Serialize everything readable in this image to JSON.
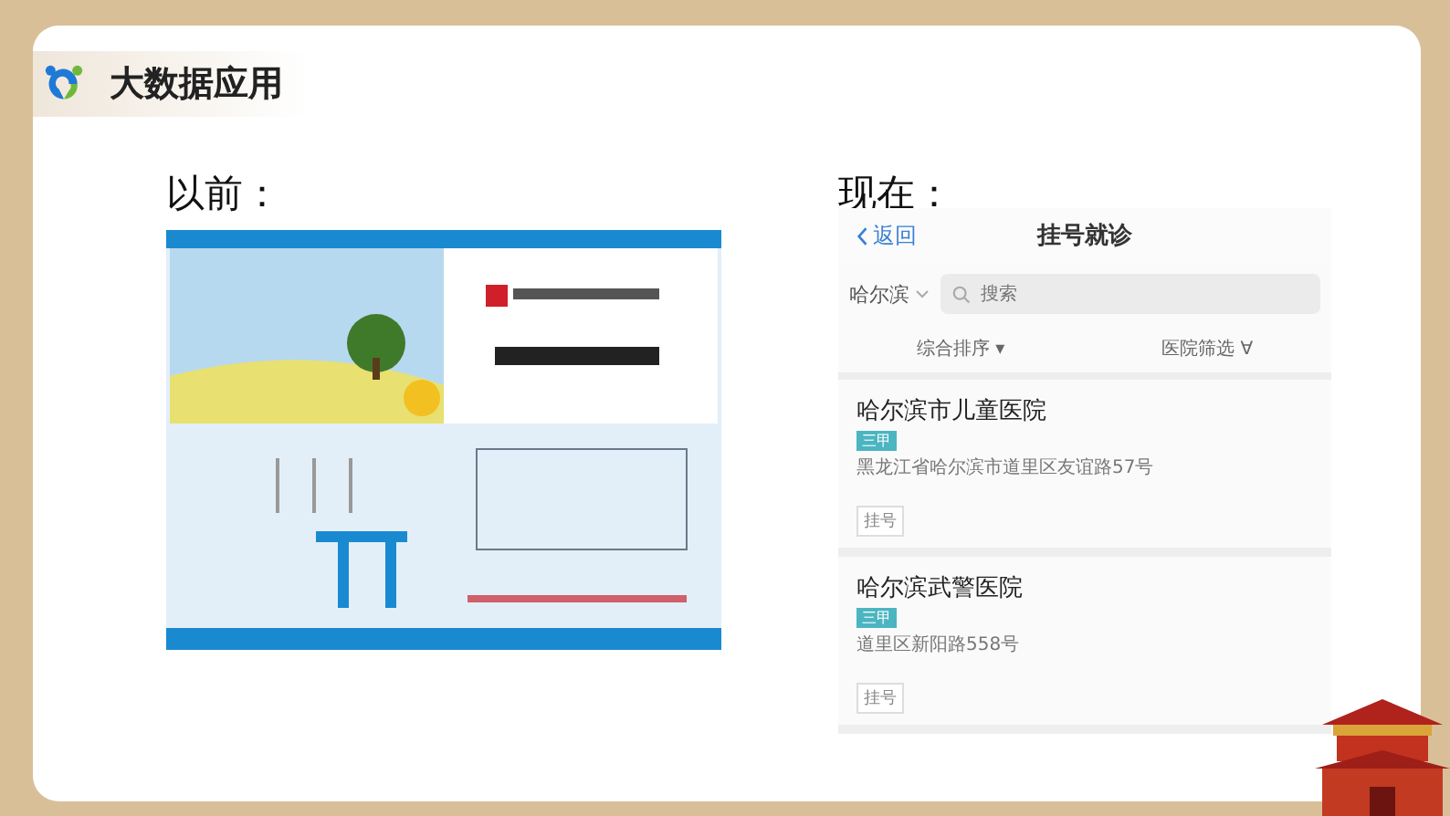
{
  "header": {
    "title": "大数据应用"
  },
  "before": {
    "label": "以前："
  },
  "after": {
    "label": "现在：",
    "app": {
      "back": "返回",
      "title": "挂号就诊",
      "city": "哈尔滨",
      "search": {
        "placeholder": "搜索"
      },
      "filters": [
        {
          "label": "综合排序",
          "marker": "▾"
        },
        {
          "label": "医院筛选",
          "marker": "∀"
        }
      ],
      "hospitals": [
        {
          "name": "哈尔滨市儿童医院",
          "tag": "三甲",
          "address": "黑龙江省哈尔滨市道里区友谊路57号",
          "action": "挂号"
        },
        {
          "name": "哈尔滨武警医院",
          "tag": "三甲",
          "address": "道里区新阳路558号",
          "action": "挂号"
        }
      ]
    }
  }
}
